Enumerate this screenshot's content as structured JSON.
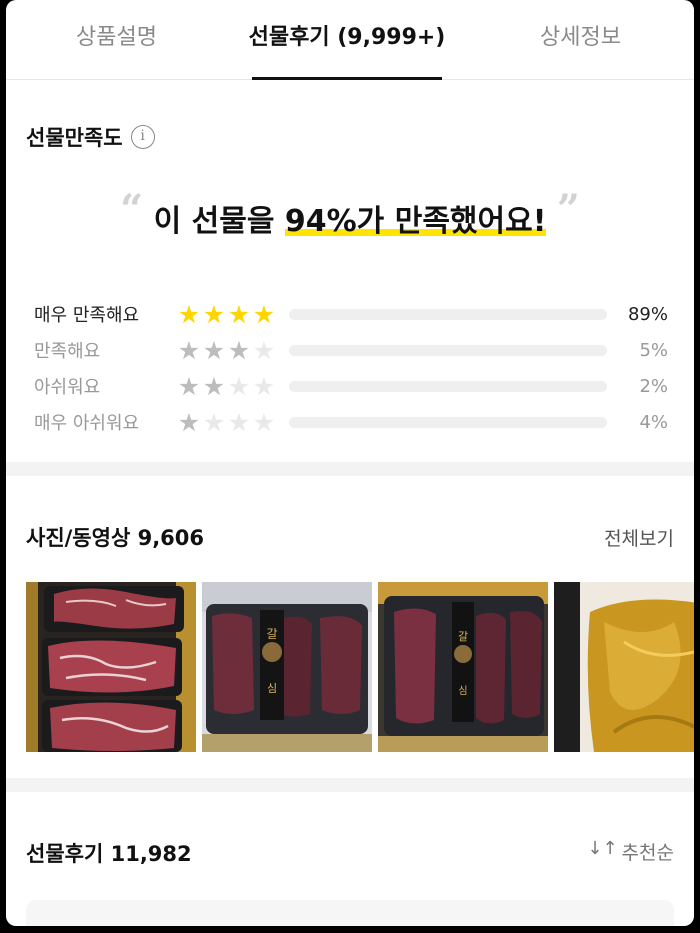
{
  "tabs": [
    {
      "label": "상품설명"
    },
    {
      "label": "선물후기 (9,999+)"
    },
    {
      "label": "상세정보"
    }
  ],
  "satisfaction": {
    "title": "선물만족도",
    "headline_prefix": "이 선물을 ",
    "headline_highlight": "94%가 만족했어요!",
    "rows": [
      {
        "label": "매우 만족해요",
        "stars": 4,
        "percent": 89,
        "percent_text": "89%"
      },
      {
        "label": "만족해요",
        "stars": 3,
        "percent": 5,
        "percent_text": "5%"
      },
      {
        "label": "아쉬워요",
        "stars": 2,
        "percent": 2,
        "percent_text": "2%"
      },
      {
        "label": "매우 아쉬워요",
        "stars": 1,
        "percent": 4,
        "percent_text": "4%"
      }
    ]
  },
  "photos": {
    "title": "사진/동영상 9,606",
    "view_all": "전체보기"
  },
  "reviews": {
    "title": "선물후기 11,982",
    "sort_label": "추천순"
  },
  "colors": {
    "accent_yellow": "#ffe400",
    "star_yellow": "#ffd600"
  }
}
